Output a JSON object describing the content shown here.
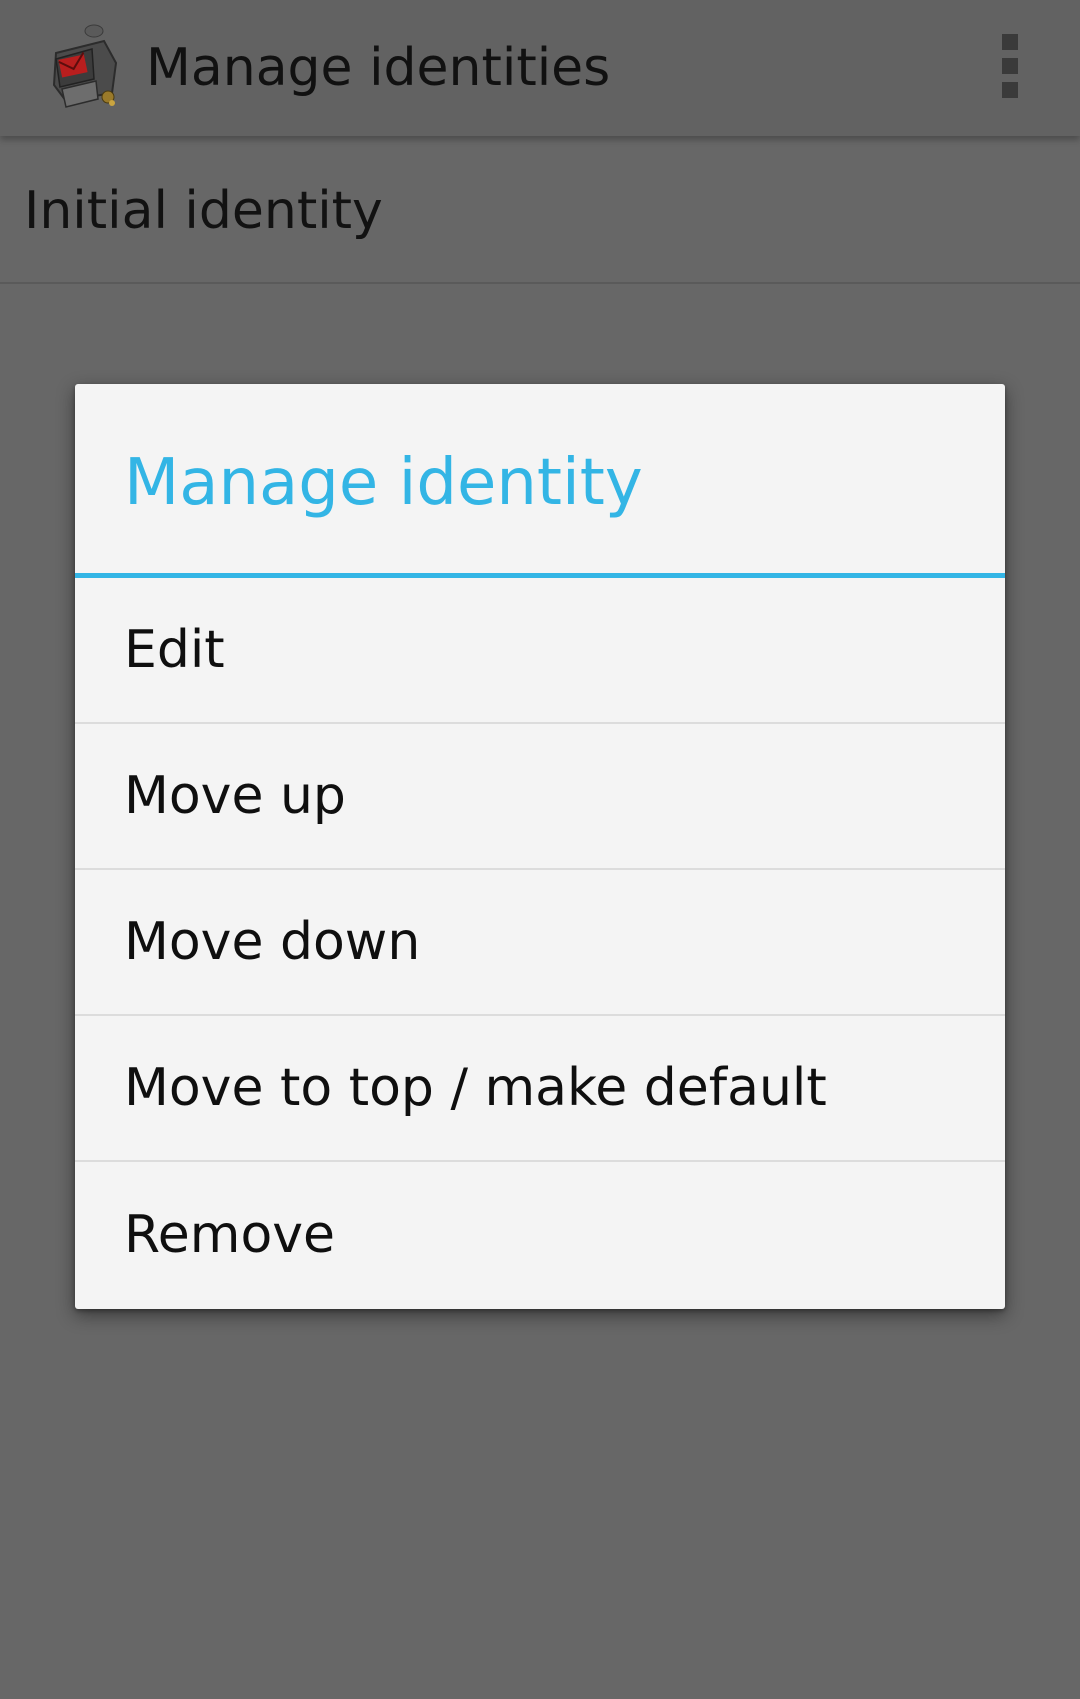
{
  "action_bar": {
    "title": "Manage identities",
    "app_icon": "k9-mail-robot-icon",
    "overflow_icon": "overflow-menu-icon"
  },
  "identities": [
    {
      "label": "Initial identity"
    }
  ],
  "dialog": {
    "title": "Manage identity",
    "accent_color": "#33b5e5",
    "items": [
      {
        "label": "Edit"
      },
      {
        "label": "Move up"
      },
      {
        "label": "Move down"
      },
      {
        "label": "Move to top / make default"
      },
      {
        "label": "Remove"
      }
    ]
  }
}
